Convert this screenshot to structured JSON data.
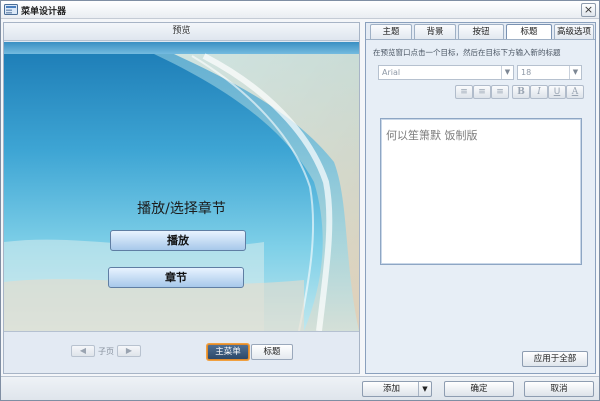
{
  "window": {
    "title": "菜单设计器",
    "close_glyph": "×"
  },
  "preview": {
    "header": "预览",
    "menu_title": "播放/选择章节",
    "buttons": [
      "播放",
      "章节"
    ],
    "footer": {
      "prev_glyph": "◀",
      "next_glyph": "▶",
      "page_label": "子页",
      "segments": [
        {
          "label": "主菜单",
          "active": true
        },
        {
          "label": "标题",
          "active": false
        }
      ]
    }
  },
  "editor": {
    "tabs": [
      {
        "label": "主题",
        "active": false
      },
      {
        "label": "背景",
        "active": false
      },
      {
        "label": "按钮",
        "active": false
      },
      {
        "label": "标题",
        "active": true
      },
      {
        "label": "高级选项",
        "active": false
      }
    ],
    "hint": "在预览窗口点击一个目标，然后在目标下方输入新的标题",
    "font_family": "Arial",
    "font_size": "18",
    "format_buttons": [
      {
        "icon": "align-left-icon",
        "glyph": "≡"
      },
      {
        "icon": "align-center-icon",
        "glyph": "≡"
      },
      {
        "icon": "align-right-icon",
        "glyph": "≡"
      },
      {
        "icon": "bold-icon",
        "glyph": "B"
      },
      {
        "icon": "italic-icon",
        "glyph": "I"
      },
      {
        "icon": "underline-icon",
        "glyph": "U"
      },
      {
        "icon": "font-color-icon",
        "glyph": "A"
      }
    ],
    "text_value": "何以笙箫默 饭制版",
    "apply_all": "应用于全部"
  },
  "bottom": {
    "add": "添加",
    "add_arrow": "▼",
    "ok": "确定",
    "cancel": "取消"
  },
  "colors": {
    "accent_active": "#2c4868",
    "highlight_border": "#f0a040",
    "button_fill": "#a7c8ea"
  }
}
